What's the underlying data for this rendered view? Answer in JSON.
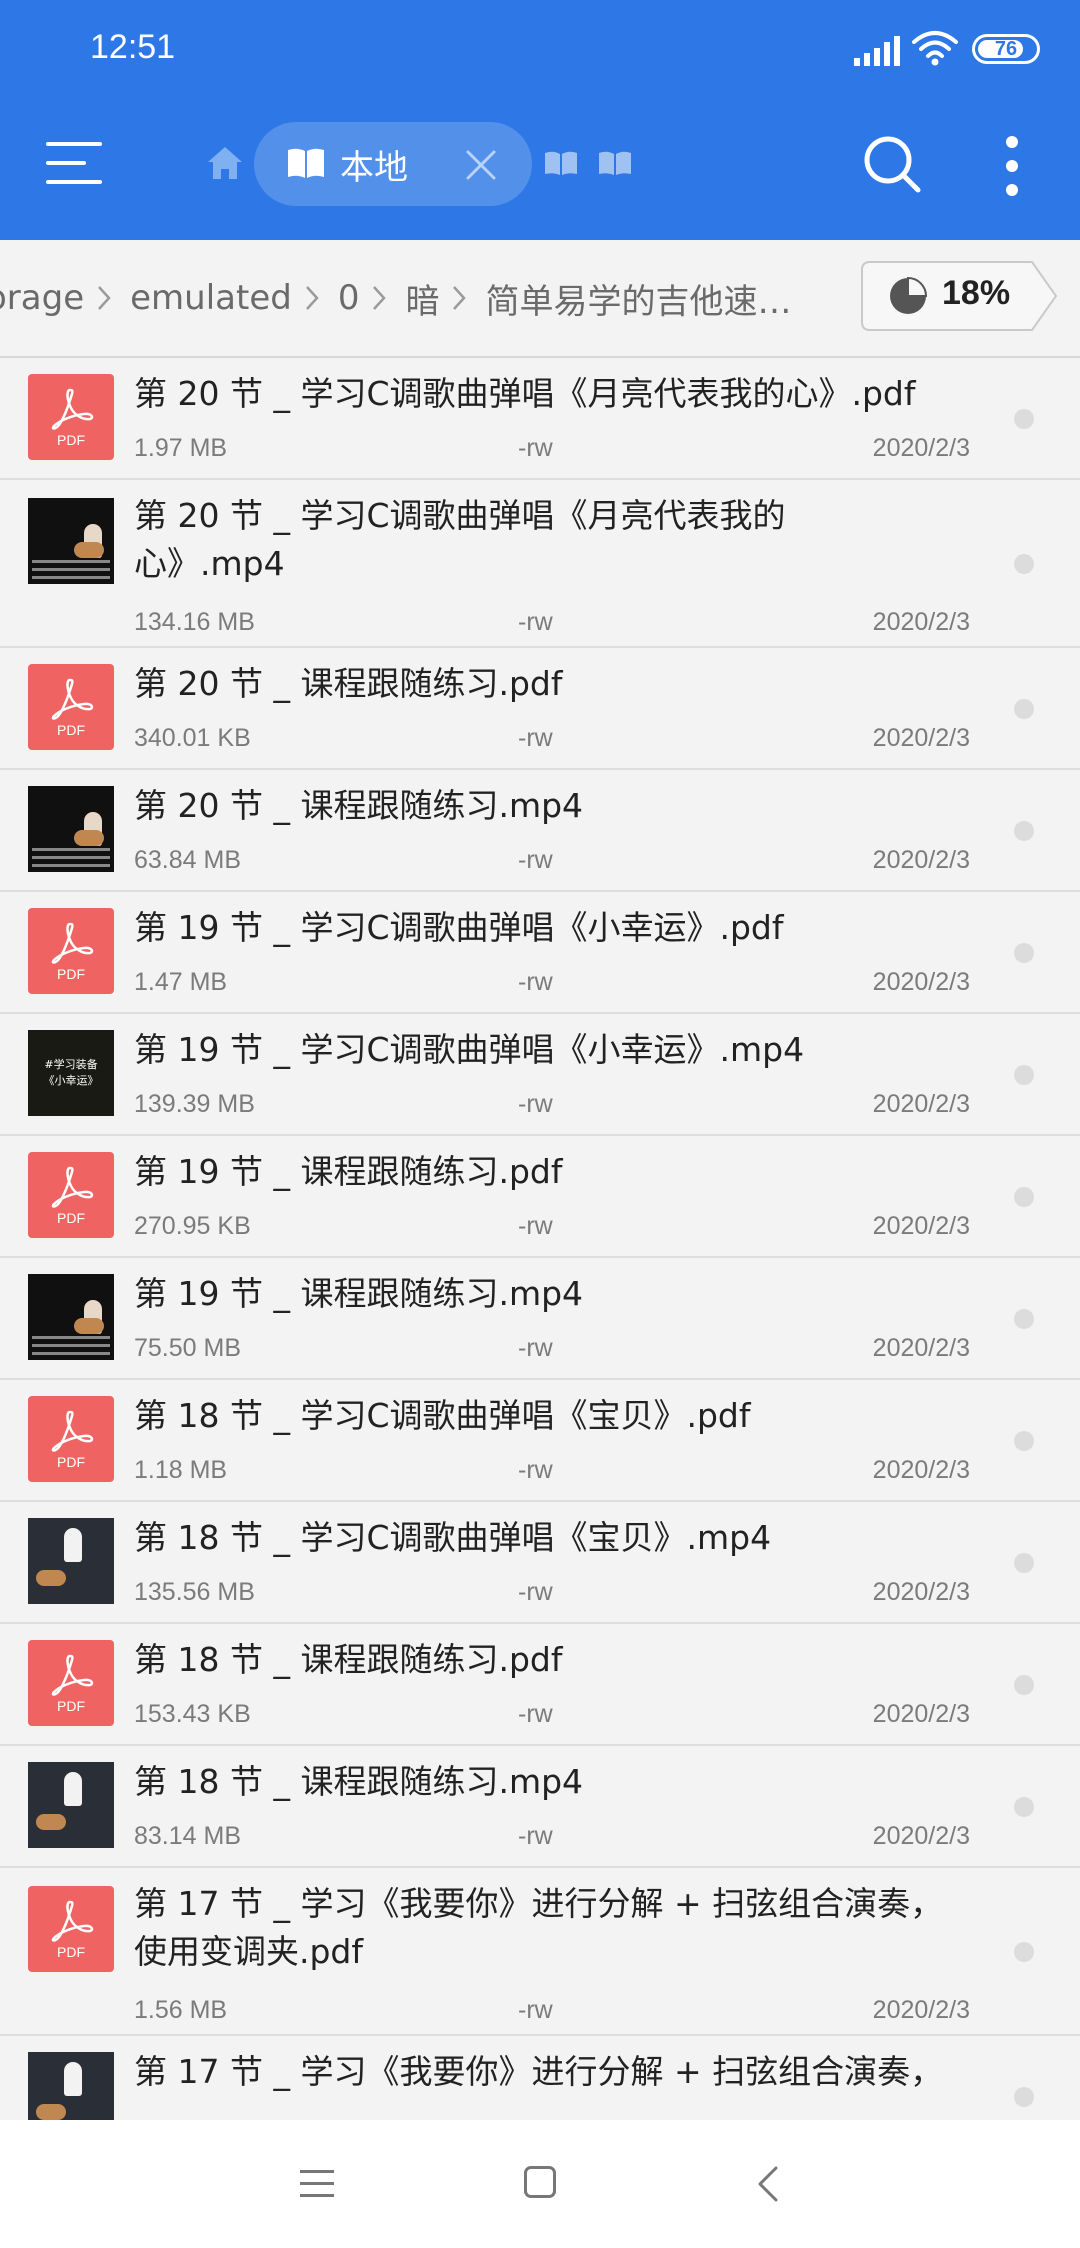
{
  "status": {
    "time": "12:51",
    "battery": "76"
  },
  "appbar": {
    "tab_label": "本地"
  },
  "breadcrumb": {
    "items": [
      "orage",
      "emulated",
      "0",
      "暗",
      "简单易学的吉他速…"
    ],
    "storage_percent": "18%"
  },
  "files": [
    {
      "type": "pdf",
      "name": "第 20 节 _ 学习C调歌曲弹唱《月亮代表我的心》.pdf",
      "size": "1.97 MB",
      "perm": "-rw",
      "date": "2020/2/3"
    },
    {
      "type": "video",
      "name": "第 20 节 _ 学习C调歌曲弹唱《月亮代表我的心》.mp4",
      "size": "134.16 MB",
      "perm": "-rw",
      "date": "2020/2/3"
    },
    {
      "type": "pdf",
      "name": "第 20 节 _ 课程跟随练习.pdf",
      "size": "340.01 KB",
      "perm": "-rw",
      "date": "2020/2/3"
    },
    {
      "type": "video",
      "name": "第 20 节 _ 课程跟随练习.mp4",
      "size": "63.84 MB",
      "perm": "-rw",
      "date": "2020/2/3"
    },
    {
      "type": "pdf",
      "name": "第 19 节 _ 学习C调歌曲弹唱《小幸运》.pdf",
      "size": "1.47 MB",
      "perm": "-rw",
      "date": "2020/2/3"
    },
    {
      "type": "video",
      "name": "第 19 节 _ 学习C调歌曲弹唱《小幸运》.mp4",
      "size": "139.39 MB",
      "perm": "-rw",
      "date": "2020/2/3"
    },
    {
      "type": "pdf",
      "name": "第 19 节 _ 课程跟随练习.pdf",
      "size": "270.95 KB",
      "perm": "-rw",
      "date": "2020/2/3"
    },
    {
      "type": "video",
      "name": "第 19 节 _ 课程跟随练习.mp4",
      "size": "75.50 MB",
      "perm": "-rw",
      "date": "2020/2/3"
    },
    {
      "type": "pdf",
      "name": "第 18 节 _ 学习C调歌曲弹唱《宝贝》.pdf",
      "size": "1.18 MB",
      "perm": "-rw",
      "date": "2020/2/3"
    },
    {
      "type": "video",
      "name": "第 18 节 _ 学习C调歌曲弹唱《宝贝》.mp4",
      "size": "135.56 MB",
      "perm": "-rw",
      "date": "2020/2/3"
    },
    {
      "type": "pdf",
      "name": "第 18 节 _ 课程跟随练习.pdf",
      "size": "153.43 KB",
      "perm": "-rw",
      "date": "2020/2/3"
    },
    {
      "type": "video",
      "name": "第 18 节 _ 课程跟随练习.mp4",
      "size": "83.14 MB",
      "perm": "-rw",
      "date": "2020/2/3"
    },
    {
      "type": "pdf",
      "name": "第 17 节 _ 学习《我要你》进行分解 + 扫弦组合演奏，使用变调夹.pdf",
      "size": "1.56 MB",
      "perm": "-rw",
      "date": "2020/2/3"
    },
    {
      "type": "video",
      "name": "第 17 节 _ 学习《我要你》进行分解 + 扫弦组合演奏，",
      "size": "",
      "perm": "",
      "date": ""
    }
  ],
  "thumb_labels": {
    "pdf": "PDF",
    "video_caption": "#学习装备\n《小幸运》"
  },
  "colors": {
    "accent": "#2d78e6",
    "pdf_red": "#f06363"
  }
}
